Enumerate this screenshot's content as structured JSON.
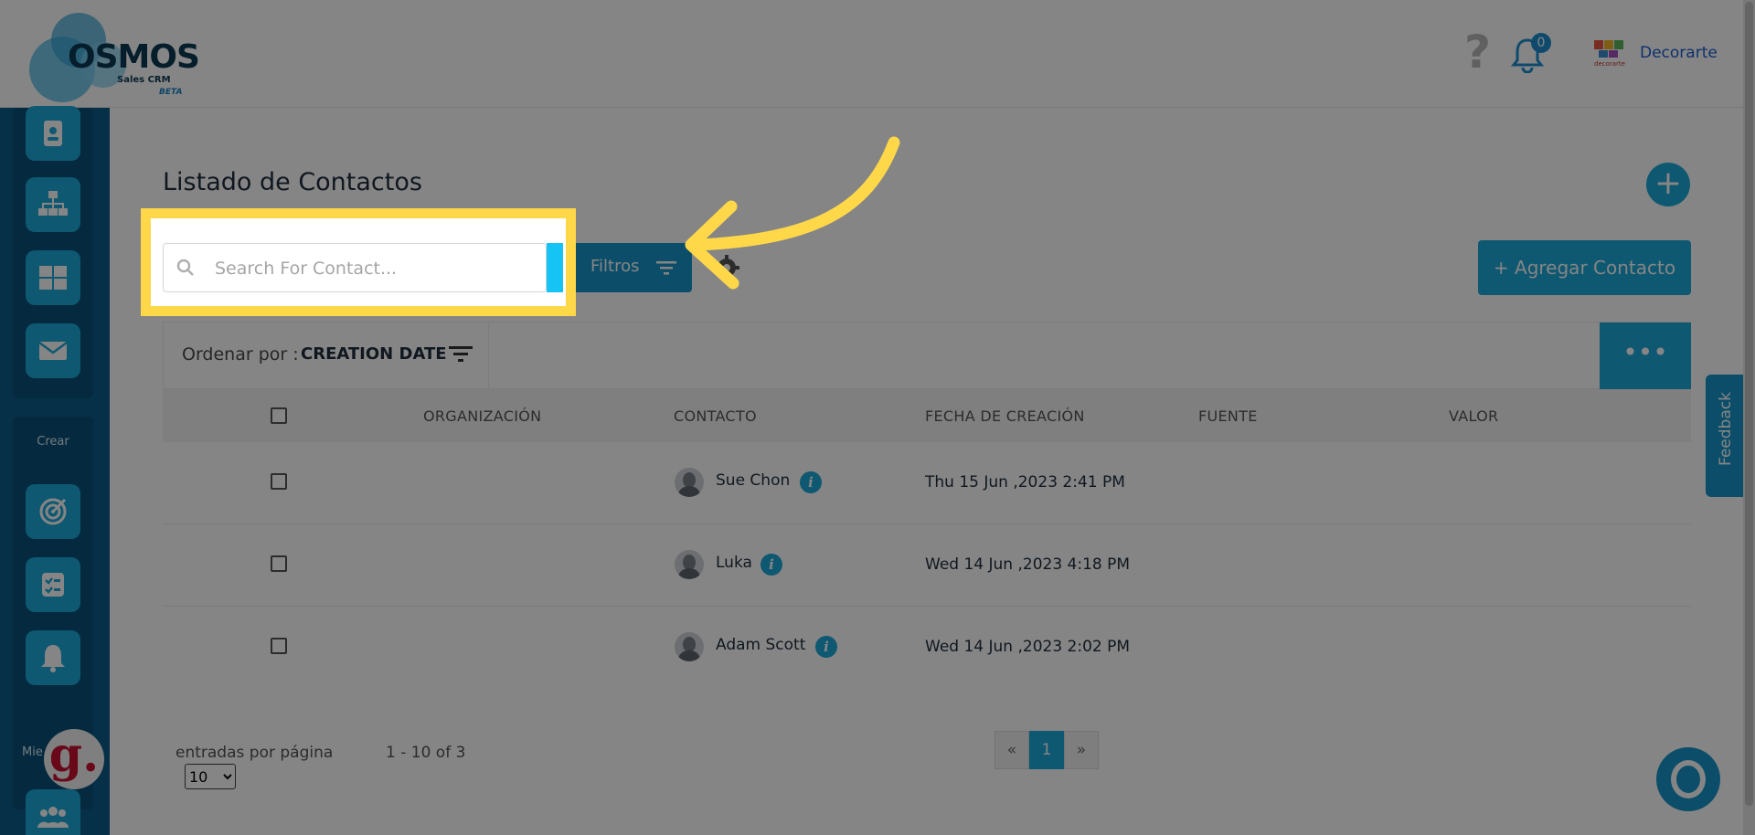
{
  "header": {
    "logo": {
      "name": "OSMOS",
      "subtitle": "Sales CRM",
      "badge": "BETA"
    },
    "help_icon": "question-mark-icon",
    "notifications": {
      "icon": "bell-icon",
      "count": "0"
    },
    "company": {
      "logo_text": "decorarte",
      "name": "Decorarte"
    }
  },
  "sidebar": {
    "section_create_label": "Crear",
    "section_members_label": "Mie",
    "items": [
      {
        "icon": "contact-card-icon"
      },
      {
        "icon": "org-chart-icon"
      },
      {
        "icon": "grid-icon"
      },
      {
        "icon": "mail-icon"
      },
      {
        "icon": "target-icon"
      },
      {
        "icon": "checklist-icon"
      },
      {
        "icon": "bell-icon"
      },
      {
        "icon": "users-icon"
      }
    ]
  },
  "main": {
    "title": "Listado de Contactos",
    "search": {
      "placeholder": "Search For Contact..."
    },
    "filters_label": "Filtros",
    "add_contact_label": "+ Agregar Contacto",
    "sort": {
      "label": "Ordenar por :",
      "value": "CREATION DATE"
    },
    "more_label": "•••",
    "columns": [
      "ORGANIZACIÓN",
      "CONTACTO",
      "FECHA DE CREACIÓN",
      "FUENTE",
      "VALOR"
    ],
    "rows": [
      {
        "organization": "",
        "contact": "Sue Chon",
        "created": "Thu 15 Jun ,2023 2:41 PM",
        "source": "",
        "value": ""
      },
      {
        "organization": "",
        "contact": "Luka",
        "created": "Wed 14 Jun ,2023 4:18 PM",
        "source": "",
        "value": ""
      },
      {
        "organization": "",
        "contact": "Adam Scott",
        "created": "Wed 14 Jun ,2023 2:02 PM",
        "source": "",
        "value": ""
      }
    ],
    "pagination": {
      "entries_label": "entradas por página",
      "per_page": "10",
      "range": "1 - 10 of 3",
      "prev": "«",
      "current": "1",
      "next": "»"
    }
  },
  "widgets": {
    "feedback_label": "Feedback",
    "g_badge": "g."
  },
  "colors": {
    "accent": "#1ca9d9",
    "highlight": "#ffd84a",
    "sidebar": "#0c5c8a"
  }
}
